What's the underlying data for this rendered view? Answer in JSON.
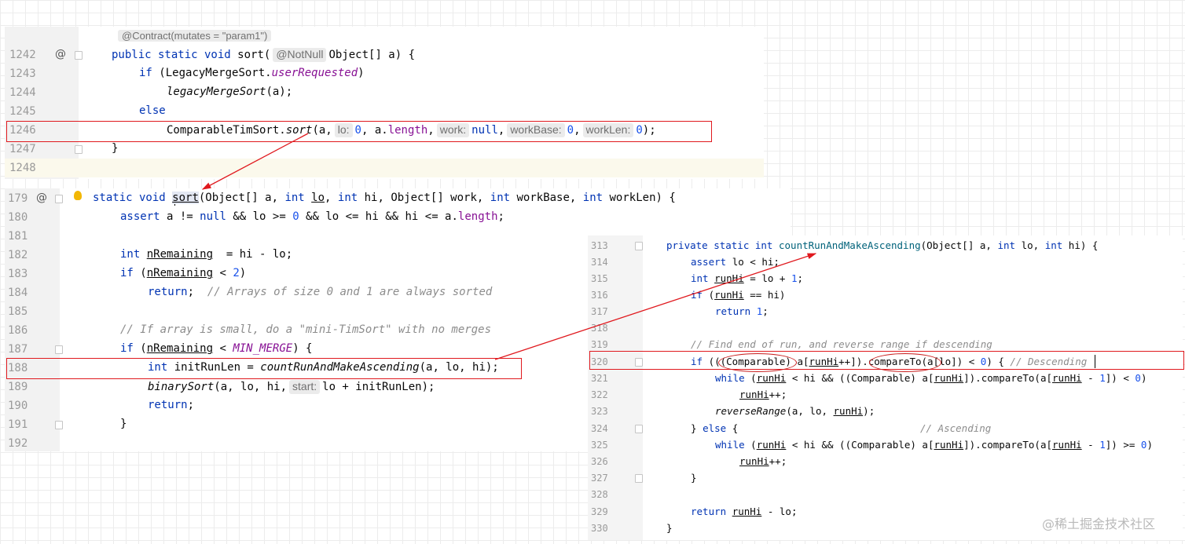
{
  "p1": {
    "annotation": "@Contract(mutates = \"param1\")",
    "at_icon": "@",
    "l1242": {
      "ln": "1242",
      "a": "public static void ",
      "b": "sort(",
      "hint": "@NotNull",
      "c": "Object[] a) {"
    },
    "l1243": {
      "ln": "1243",
      "a": "if ",
      "b": "(LegacyMergeSort.",
      "c": "userRequested",
      "d": ")"
    },
    "l1244": {
      "ln": "1244",
      "a": "legacyMergeSort",
      "b": "(a);"
    },
    "l1245": {
      "ln": "1245",
      "a": "else"
    },
    "l1246": {
      "ln": "1246",
      "a": "ComparableTimSort.",
      "b": "sort",
      "c": "(a,",
      "h1": "lo:",
      "d": "0",
      "e": ", a.",
      "f": "length",
      "g": ",",
      "h2": "work:",
      "i": "null",
      "j": ",",
      "h3": "workBase:",
      "k": "0",
      "l": ",",
      "h4": "workLen:",
      "m": "0",
      "n": ");"
    },
    "l1247": {
      "ln": "1247",
      "a": "}"
    },
    "l1248": {
      "ln": "1248"
    }
  },
  "p2": {
    "l179": {
      "ln": "179",
      "at": "@",
      "a": "static void ",
      "b": "sort",
      "c": "(Object[] a, ",
      "d": "int ",
      "e": "lo",
      "f": ", ",
      "g": "int ",
      "h": "hi, Object[] work, ",
      "i": "int ",
      "j": "workBase, ",
      "k": "int ",
      "l": "workLen) {"
    },
    "l180": {
      "ln": "180",
      "a": "assert ",
      "b": "a != ",
      "c": "null ",
      "d": "&& lo >= ",
      "e": "0 ",
      "f": "&& lo <= hi && hi <= a.",
      "g": "length",
      "h": ";"
    },
    "l181": {
      "ln": "181"
    },
    "l182": {
      "ln": "182",
      "a": "int ",
      "b": "nRemaining",
      "c": "  = hi - lo;"
    },
    "l183": {
      "ln": "183",
      "a": "if ",
      "b": "(",
      "c": "nRemaining",
      "d": " < ",
      "e": "2",
      "f": ")"
    },
    "l184": {
      "ln": "184",
      "a": "return",
      "b": ";  ",
      "c": "// Arrays of size 0 and 1 are always sorted"
    },
    "l185": {
      "ln": "185"
    },
    "l186": {
      "ln": "186",
      "a": "// If array is small, do a \"mini-TimSort\" with no merges"
    },
    "l187": {
      "ln": "187",
      "a": "if ",
      "b": "(",
      "c": "nRemaining",
      "d": " < ",
      "e": "MIN_MERGE",
      "f": ") {"
    },
    "l188": {
      "ln": "188",
      "a": "int ",
      "b": "initRunLen = ",
      "c": "countRunAndMakeAscending",
      "d": "(a, lo, hi);"
    },
    "l189": {
      "ln": "189",
      "a": "binarySort",
      "b": "(a, lo, hi,",
      "hint": "start:",
      "c": "lo + initRunLen);"
    },
    "l190": {
      "ln": "190",
      "a": "return",
      "b": ";"
    },
    "l191": {
      "ln": "191",
      "a": "}"
    },
    "l192": {
      "ln": "192"
    }
  },
  "p3": {
    "l313": {
      "ln": "313",
      "a": "private static int ",
      "b": "countRunAndMakeAscending",
      "c": "(Object[] a, ",
      "d": "int ",
      "e": "lo, ",
      "f": "int ",
      "g": "hi) {"
    },
    "l314": {
      "ln": "314",
      "a": "assert ",
      "b": "lo < hi;"
    },
    "l315": {
      "ln": "315",
      "a": "int ",
      "b": "runHi",
      "c": " = lo + ",
      "d": "1",
      "e": ";"
    },
    "l316": {
      "ln": "316",
      "a": "if ",
      "b": "(",
      "c": "runHi",
      "d": " == hi)"
    },
    "l317": {
      "ln": "317",
      "a": "return ",
      "b": "1",
      "c": ";"
    },
    "l318": {
      "ln": "318"
    },
    "l319": {
      "ln": "319",
      "a": "// Find end of run, and reverse range if descending"
    },
    "l320": {
      "ln": "320",
      "a": "if ",
      "b": "(((Comparable) a[",
      "c": "runHi",
      "d": "++]).compareTo(a[lo]) < ",
      "e": "0",
      "f": ") { ",
      "g": "// Descending"
    },
    "l321": {
      "ln": "321",
      "a": "while ",
      "b": "(",
      "c": "runHi",
      "d": " < hi && ((Comparable) a[",
      "e": "runHi",
      "f": "]).compareTo(a[",
      "g": "runHi",
      "h": " - ",
      "i": "1",
      "j": "]) < ",
      "k": "0",
      "l": ")"
    },
    "l322": {
      "ln": "322",
      "a": "runHi",
      "b": "++;"
    },
    "l323": {
      "ln": "323",
      "a": "reverseRange",
      "b": "(a, lo, ",
      "c": "runHi",
      "d": ");"
    },
    "l324": {
      "ln": "324",
      "a": "} ",
      "b": "else ",
      "c": "{",
      "d": "// Ascending"
    },
    "l325": {
      "ln": "325",
      "a": "while ",
      "b": "(",
      "c": "runHi",
      "d": " < hi && ((Comparable) a[",
      "e": "runHi",
      "f": "]).compareTo(a[",
      "g": "runHi",
      "h": " - ",
      "i": "1",
      "j": "]) >= ",
      "k": "0",
      "l": ")"
    },
    "l326": {
      "ln": "326",
      "a": "runHi",
      "b": "++;"
    },
    "l327": {
      "ln": "327",
      "a": "}"
    },
    "l328": {
      "ln": "328"
    },
    "l329": {
      "ln": "329",
      "a": "return ",
      "b": "runHi",
      "c": " - lo;"
    },
    "l330": {
      "ln": "330",
      "a": "}"
    }
  },
  "watermark": "@稀土掘金技术社区",
  "colors": {
    "annotation_red": "#e0191e",
    "keyword": "#0033b3",
    "number": "#1750eb",
    "field": "#871094",
    "comment": "#8c8c8c"
  }
}
